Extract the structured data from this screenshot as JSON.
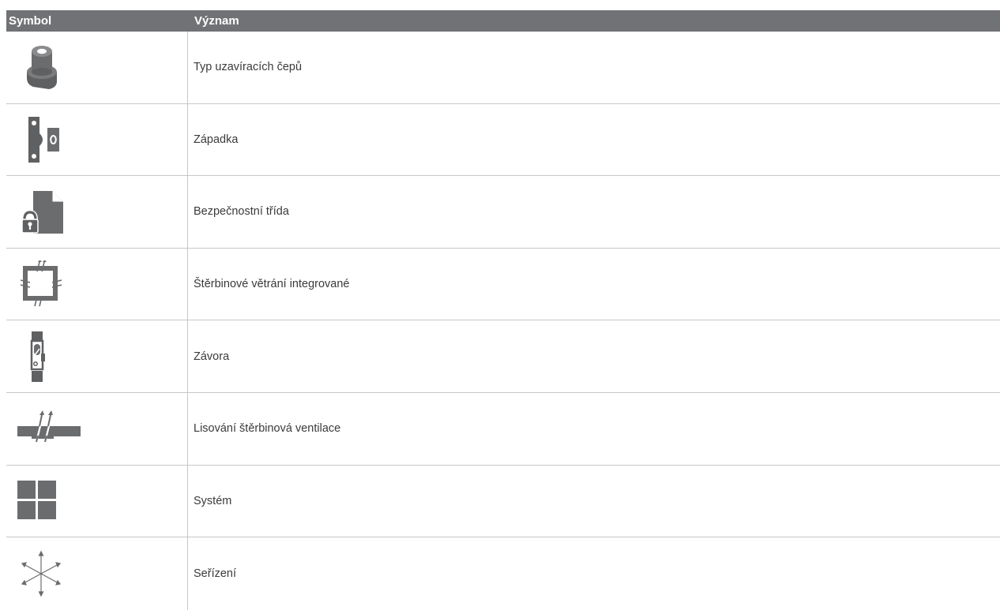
{
  "header": {
    "symbol": "Symbol",
    "meaning": "Význam"
  },
  "rows": [
    {
      "icon": "locking-pin-icon",
      "label": "Typ uzavíracích čepů"
    },
    {
      "icon": "latch-icon",
      "label": "Západka"
    },
    {
      "icon": "security-class-icon",
      "label": "Bezpečnostní třída"
    },
    {
      "icon": "integrated-slot-ventilation-icon",
      "label": "Štěrbinové větrání integrované"
    },
    {
      "icon": "bolt-icon",
      "label": "Závora"
    },
    {
      "icon": "slot-ventilation-pressing-icon",
      "label": "Lisování štěrbinová ventilace"
    },
    {
      "icon": "system-icon",
      "label": "Systém"
    },
    {
      "icon": "adjustment-icon",
      "label": "Seřízení"
    }
  ],
  "colors": {
    "header_bg": "#717275",
    "icon_gray": "#6b6c6e",
    "grid": "#c7c7c7"
  }
}
